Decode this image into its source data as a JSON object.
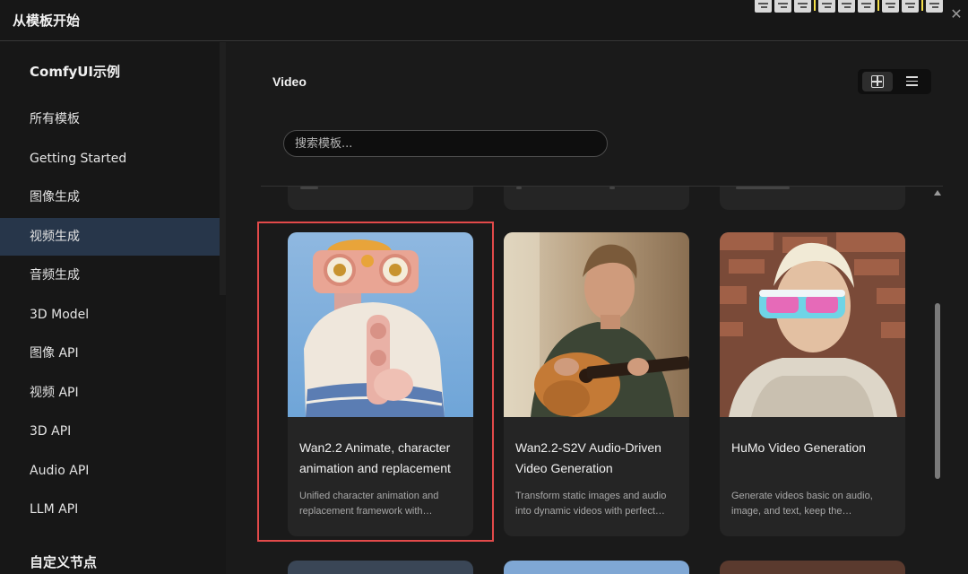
{
  "window": {
    "title": "从模板开始",
    "close_glyph": "✕"
  },
  "sidebar": {
    "heading": "ComfyUI示例",
    "items": [
      {
        "label": "所有模板"
      },
      {
        "label": "Getting Started"
      },
      {
        "label": "图像生成"
      },
      {
        "label": "视频生成",
        "active": true
      },
      {
        "label": "音频生成"
      },
      {
        "label": "3D Model"
      },
      {
        "label": "图像 API"
      },
      {
        "label": "视频 API"
      },
      {
        "label": "3D API"
      },
      {
        "label": "Audio API"
      },
      {
        "label": "LLM API"
      }
    ],
    "section2_heading": "自定义节点"
  },
  "main": {
    "section_title": "Video",
    "view_mode": "grid",
    "search": {
      "placeholder": "搜索模板...",
      "value": ""
    },
    "cards": [
      {
        "title": "Wan2.2 Animate, character animation and replacement",
        "description": "Unified character animation and replacement framework with…",
        "selected": true,
        "thumbnail_icon": "pink-robot-with-knit-hat-image"
      },
      {
        "title": "Wan2.2-S2V Audio-Driven Video Generation",
        "description": "Transform static images and audio into dynamic videos with perfect…",
        "selected": false,
        "thumbnail_icon": "man-playing-guitar-image"
      },
      {
        "title": "HuMo Video Generation",
        "description": "Generate videos basic on audio, image, and text, keep the…",
        "selected": false,
        "thumbnail_icon": "boy-with-vr-glasses-image"
      }
    ]
  },
  "colors": {
    "accent_selected": "#e24a4a",
    "sidebar_active": "#27364a",
    "toolbar_marker": "#f5e04a"
  }
}
